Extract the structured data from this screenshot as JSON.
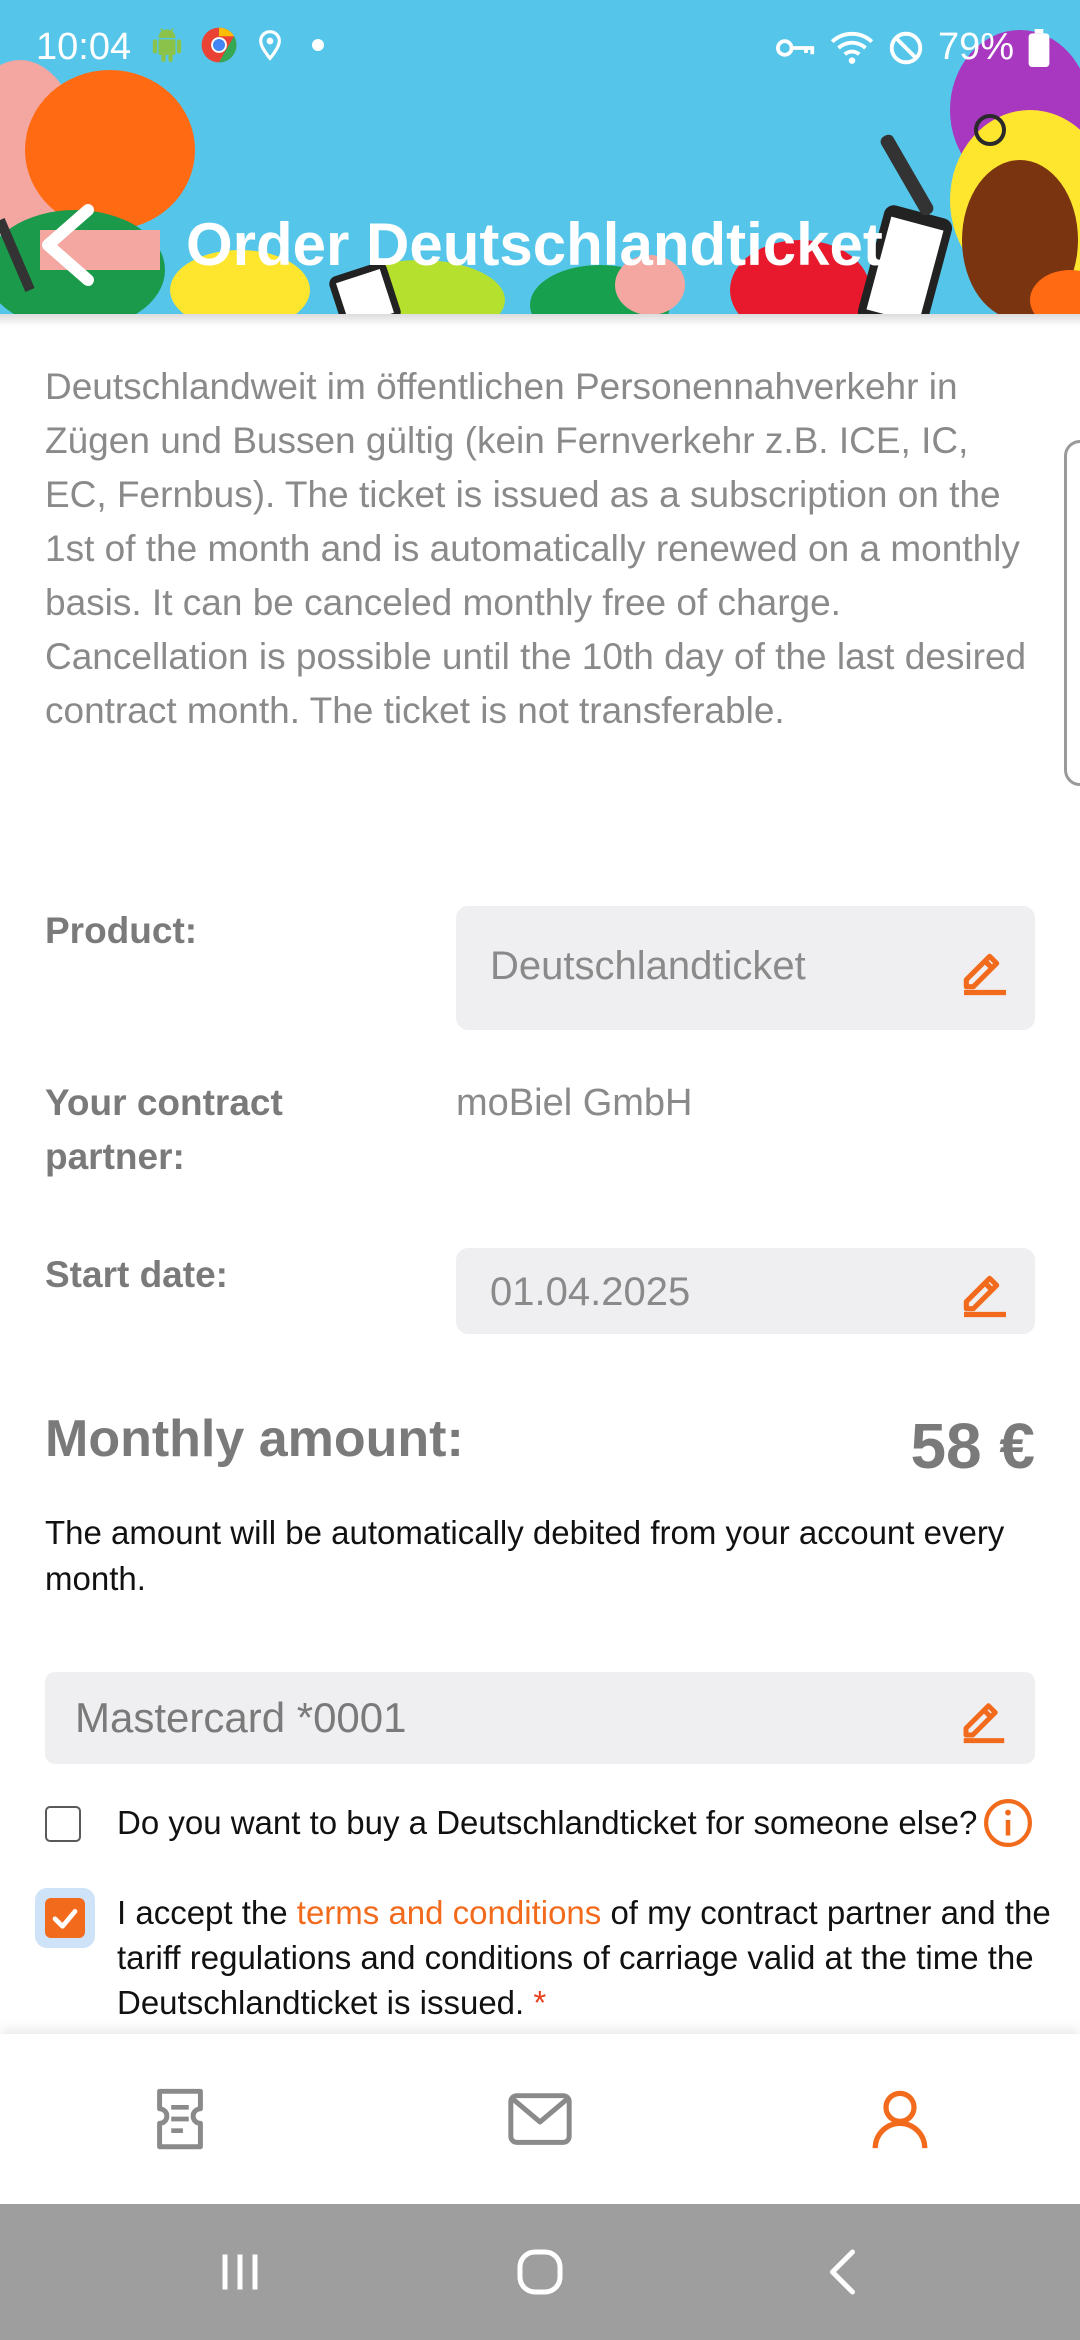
{
  "status_bar": {
    "time": "10:04",
    "battery": "79%",
    "icons": [
      "android-icon",
      "chrome-icon",
      "location-icon",
      "dot-icon",
      "key-icon",
      "wifi-icon",
      "do-not-disturb-icon",
      "battery-icon"
    ]
  },
  "header": {
    "title": "Order Deutschlandticket",
    "background_color": "#55c6ea"
  },
  "description": "Deutschlandweit im öffentlichen Personennahverkehr in Zügen und Bussen gültig (kein Fernverkehr z.B. ICE, IC, EC, Fernbus). The ticket is issued as a subscription on the 1st of the month and is automatically renewed on a monthly basis. It can be canceled monthly free of charge. Cancellation is possible until the 10th day of the last desired contract month. The ticket is not transferable.",
  "form": {
    "product": {
      "label": "Product:",
      "value": "Deutschlandticket"
    },
    "contract_partner": {
      "label": "Your contract partner:",
      "value": "moBiel GmbH"
    },
    "start_date": {
      "label": "Start date:",
      "value": "01.04.2025"
    }
  },
  "amount": {
    "label": "Monthly amount:",
    "value": "58 €",
    "note": "The amount will be automatically debited from your account every month."
  },
  "payment": {
    "value": "Mastercard *0001"
  },
  "someone_else": {
    "label": "Do you want to buy a Deutschlandticket for someone else?",
    "checked": false
  },
  "terms": {
    "prefix": "I accept the ",
    "link": "terms and conditions",
    "suffix": " of my contract partner and the tariff regulations and conditions of carriage valid at the time the Deutschlandticket is issued. ",
    "required_mark": "*",
    "checked": true
  },
  "bottom_nav": {
    "items": [
      "tickets-icon",
      "messages-icon",
      "profile-icon"
    ],
    "active": "profile-icon"
  },
  "colors": {
    "accent": "#f26b1d",
    "muted_text": "#8a8a8a",
    "field_bg": "#efeff1"
  }
}
